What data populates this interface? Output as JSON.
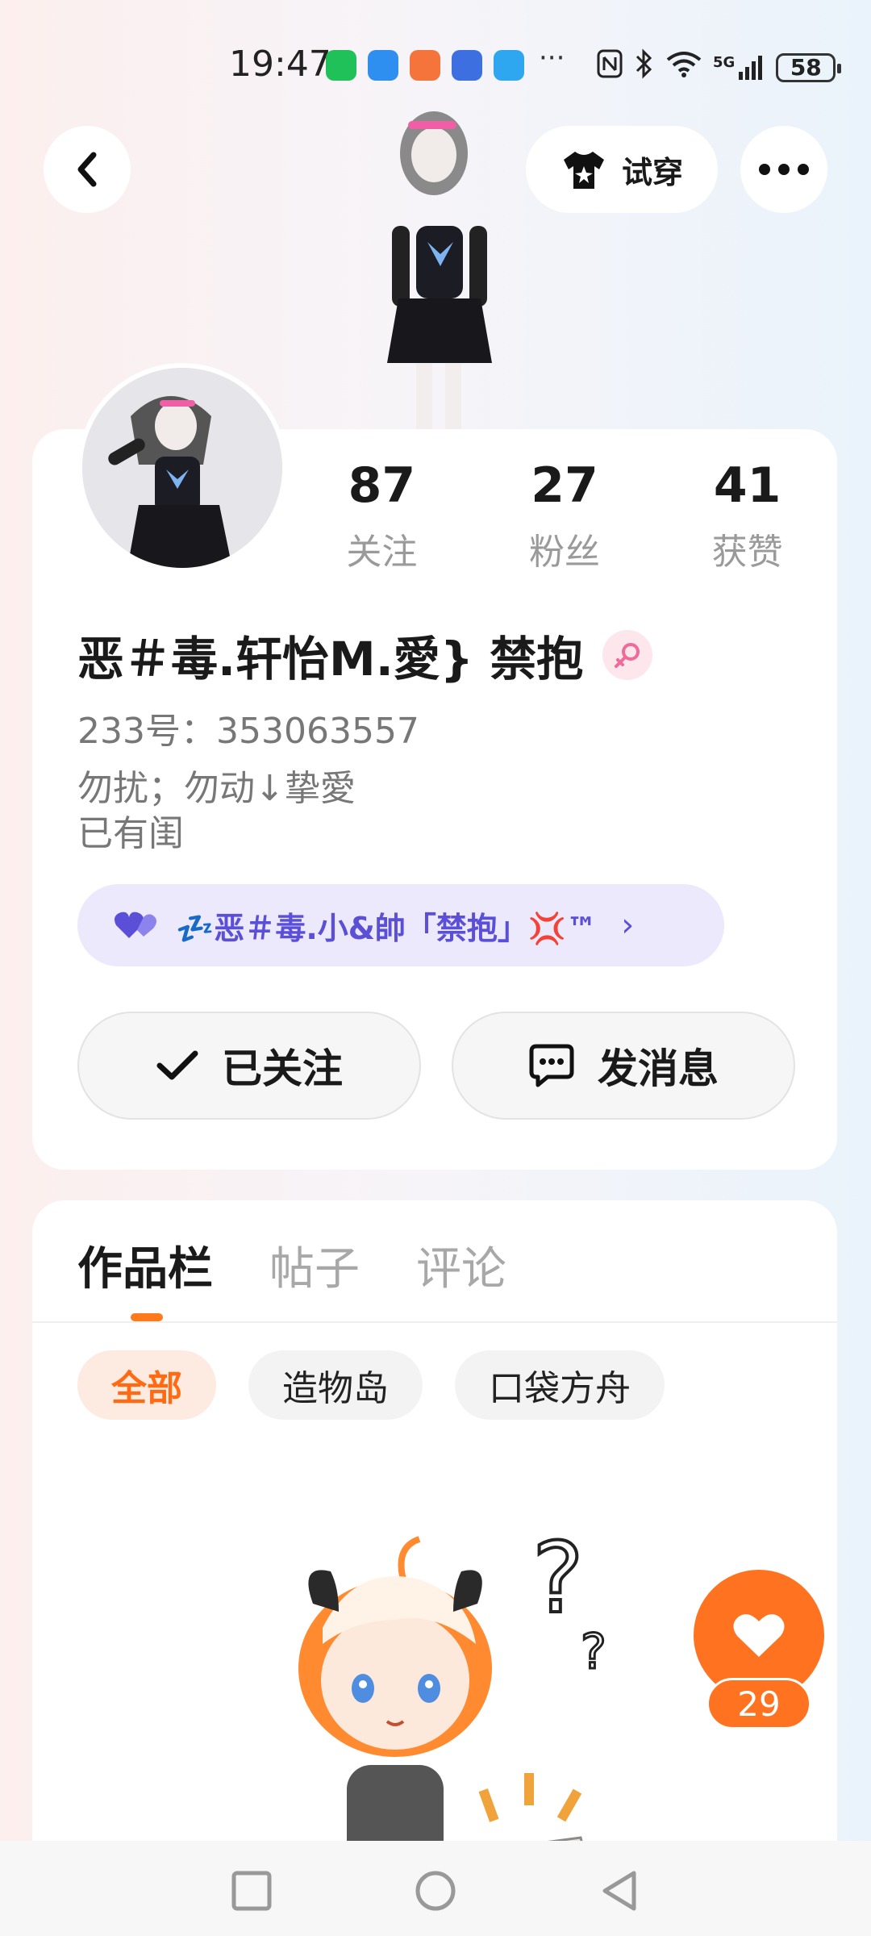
{
  "status_bar": {
    "time": "19:47",
    "more": "···",
    "signal_label": "5G",
    "battery": "58"
  },
  "header": {
    "tryon_label": "试穿"
  },
  "profile": {
    "stats": [
      {
        "value": "87",
        "label": "关注"
      },
      {
        "value": "27",
        "label": "粉丝"
      },
      {
        "value": "41",
        "label": "获赞"
      }
    ],
    "username": "恶＃毒.轩怡M.愛}  禁抱",
    "user_id": "233号：353063557",
    "bio_line1": "勿扰；勿动↓挚愛",
    "bio_line2": "已有闺",
    "family_name": "💤恶＃毒.小&帥「禁抱」💢™",
    "family_chevron": "›",
    "follow_label": "已关注",
    "message_label": "发消息"
  },
  "works": {
    "tabs": [
      "作品栏",
      "帖子",
      "评论"
    ],
    "chips": [
      "全部",
      "造物岛",
      "口袋方舟"
    ]
  },
  "like": {
    "count": "29"
  },
  "colors": {
    "accent": "#ff7220",
    "family_text": "#5b4fd8",
    "family_bg": "#ebe9fb"
  }
}
